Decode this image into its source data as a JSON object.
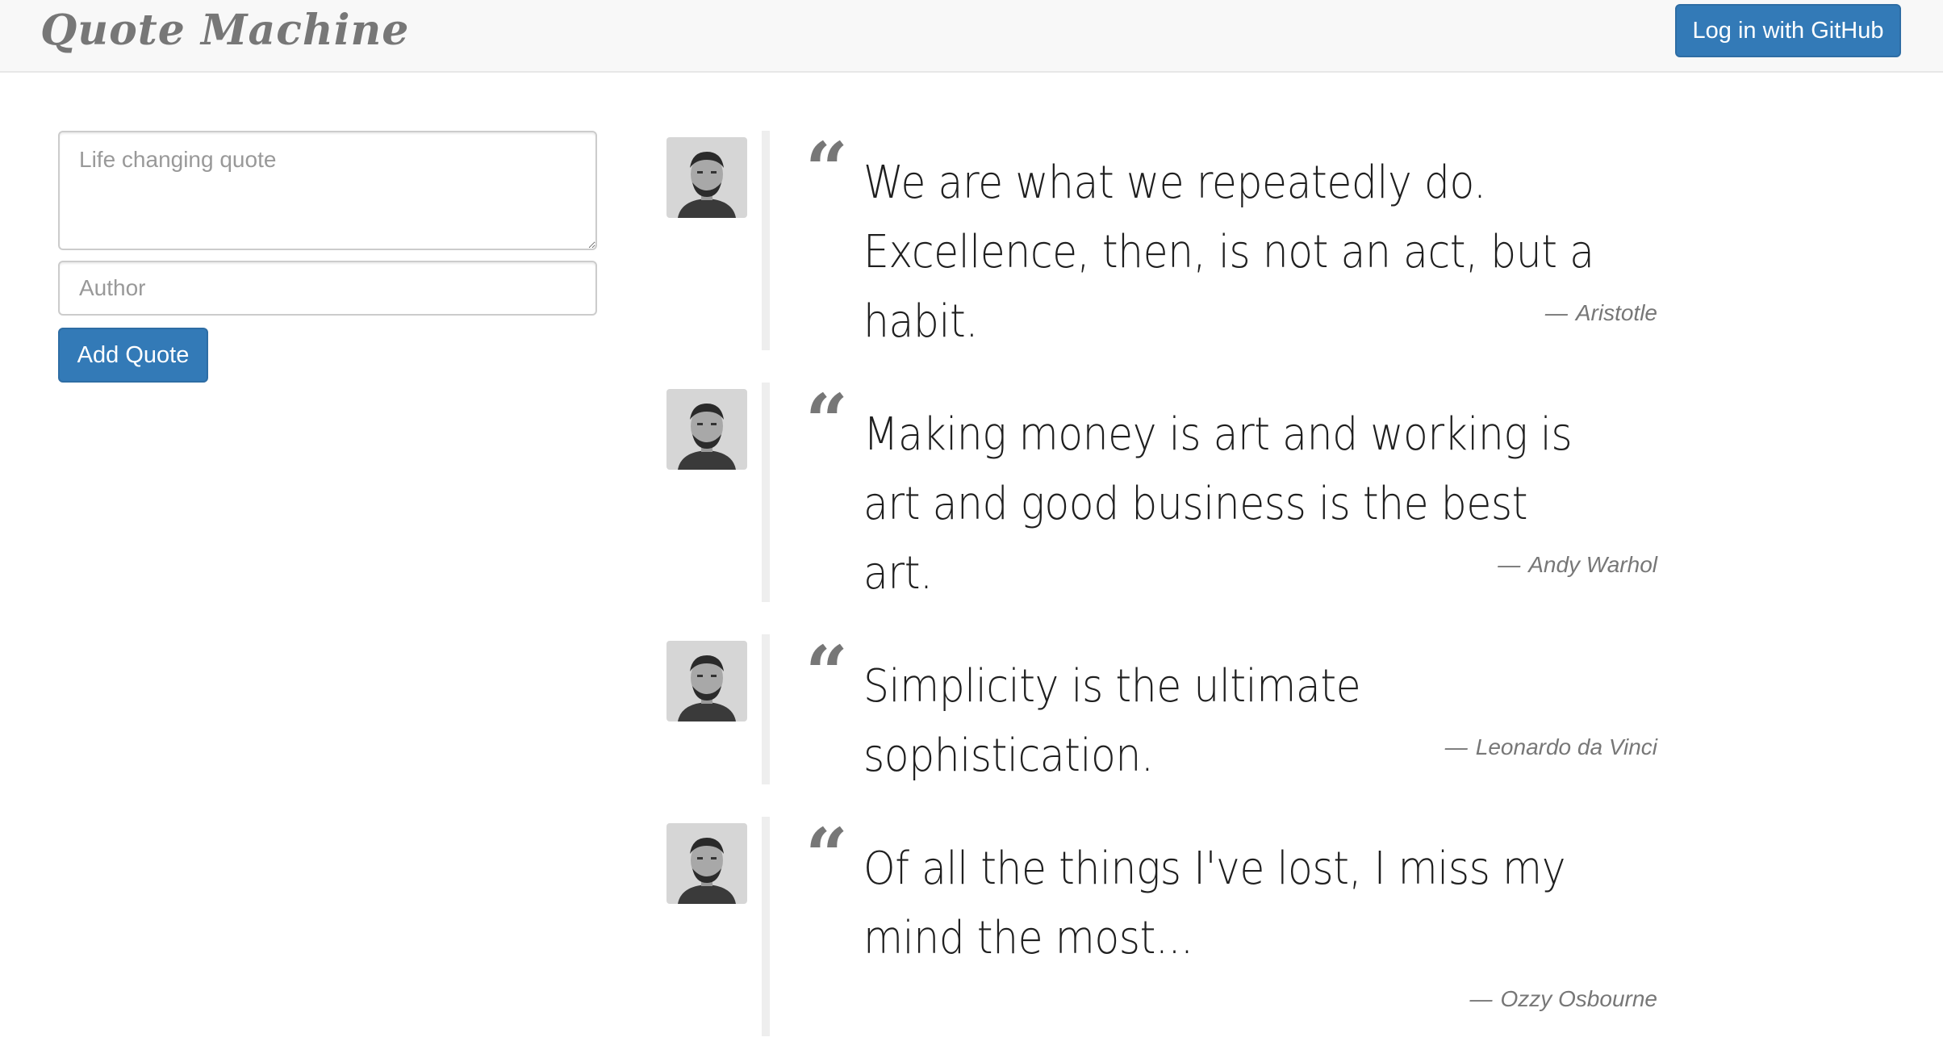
{
  "navbar": {
    "brand": "Quote Machine",
    "login_label": "Log in with GitHub"
  },
  "form": {
    "quote_placeholder": "Life changing quote",
    "author_placeholder": "Author",
    "add_label": "Add Quote"
  },
  "quotes": [
    {
      "text": "We are what we repeatedly do. Excellence, then, is not an act, but a habit.",
      "author": "Aristotle"
    },
    {
      "text": "Making money is art and working is art and good business is the best art.",
      "author": "Andy Warhol"
    },
    {
      "text": "Simplicity is the ultimate sophistication.",
      "author": "Leonardo da Vinci"
    },
    {
      "text": "Of all the things I've lost, I miss my mind the most...",
      "author": "Ozzy Osbourne"
    }
  ],
  "quote_mark": "“",
  "footer_dash": "—",
  "icons": {
    "avatar": "user-avatar-icon"
  },
  "colors": {
    "accent": "#337ab7",
    "muted": "#777777",
    "border": "#eeeeee"
  }
}
